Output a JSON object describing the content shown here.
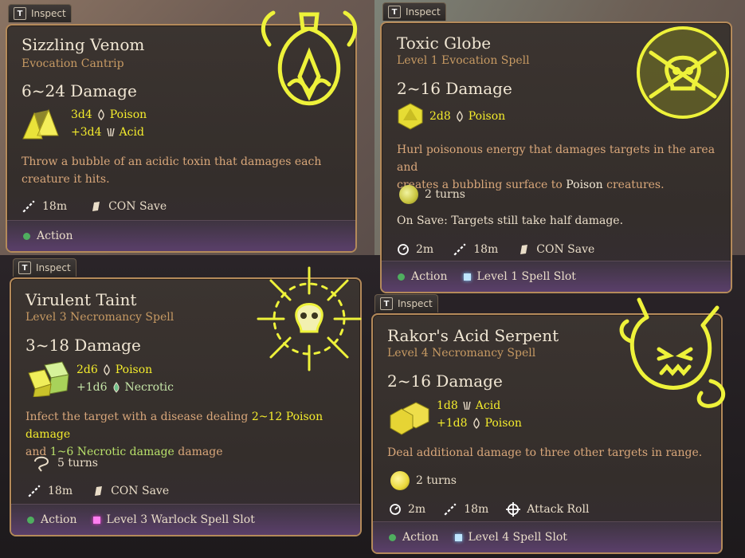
{
  "colors": {
    "accent_yellow": "#f4ec2c",
    "subtitle": "#c79a63",
    "desc": "#d9a77a",
    "action_dot": "#4fae5f"
  },
  "inspect_label": "Inspect",
  "inspect_key": "T",
  "cards": [
    {
      "title": "Sizzling Venom",
      "subtitle": "Evocation Cantrip",
      "damage": "6~24 Damage",
      "dmg_lines": [
        {
          "dice": "3d4",
          "type": "Poison"
        },
        {
          "dice": "+3d4",
          "type": "Acid"
        }
      ],
      "desc_a": "Throw a bubble of an acidic toxin that damages each",
      "desc_b": "creature it hits.",
      "range": "18m",
      "save": "CON Save",
      "action": "Action",
      "icon": "venom-flask-icon"
    },
    {
      "title": "Toxic Globe",
      "subtitle": "Level 1 Evocation Spell",
      "damage": "2~16 Damage",
      "dmg_lines": [
        {
          "dice": "2d8",
          "type": "Poison"
        }
      ],
      "desc_a": "Hurl poisonous energy that damages targets in the area and",
      "desc_b1": "creates a bubbling surface to ",
      "desc_b_hl": "Poison",
      "desc_b2": " creatures.",
      "turns": "2 turns",
      "on_save": "On Save: Targets still take half damage.",
      "cooldown": "2m",
      "range": "18m",
      "save": "CON Save",
      "action": "Action",
      "slot": "Level 1 Spell Slot",
      "icon": "skull-crossbones-icon"
    },
    {
      "title": "Virulent Taint",
      "subtitle": "Level 3 Necromancy Spell",
      "damage": "3~18 Damage",
      "dmg_lines": [
        {
          "dice": "2d6",
          "type": "Poison"
        },
        {
          "dice": "+1d6",
          "type": "Necrotic"
        }
      ],
      "desc_a1": "Infect the target with a disease dealing ",
      "desc_a_hl": "2~12 Poison damage",
      "desc_b1": "and ",
      "desc_b_hl": "1~6 Necrotic damage",
      "desc_b2": " damage",
      "turns": "5 turns",
      "range": "18m",
      "save": "CON Save",
      "action": "Action",
      "slot": "Level 3 Warlock Spell Slot",
      "icon": "radiant-skull-icon"
    },
    {
      "title": "Rakor's Acid Serpent",
      "subtitle": "Level 4 Necromancy Spell",
      "damage": "2~16 Damage",
      "dmg_lines": [
        {
          "dice": "1d8",
          "type": "Acid"
        },
        {
          "dice": "+1d8",
          "type": "Poison"
        }
      ],
      "desc_a": "Deal additional damage to three other targets in range.",
      "turns": "2 turns",
      "cooldown": "2m",
      "range": "18m",
      "attack": "Attack Roll",
      "action": "Action",
      "slot": "Level 4 Spell Slot",
      "icon": "serpent-head-icon"
    }
  ]
}
